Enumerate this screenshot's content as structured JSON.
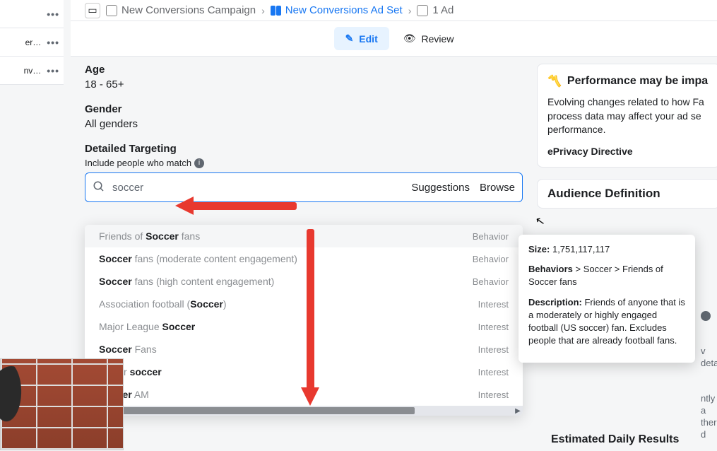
{
  "sidebar_items": [
    "",
    "er…",
    "nv…"
  ],
  "breadcrumb": {
    "campaign": "New Conversions Campaign",
    "adset": "New Conversions Ad Set",
    "ad": "1 Ad"
  },
  "actions": {
    "edit": "Edit",
    "review": "Review"
  },
  "form": {
    "age_label": "Age",
    "age_value": "18 - 65+",
    "gender_label": "Gender",
    "gender_value": "All genders",
    "targeting_label": "Detailed Targeting",
    "include_label": "Include people who match",
    "search_value": "soccer",
    "suggestions": "Suggestions",
    "browse": "Browse"
  },
  "dropdown": [
    {
      "pre": "Friends of ",
      "bold": "Soccer",
      "post": " fans",
      "cat": "Behavior"
    },
    {
      "pre": "",
      "bold": "Soccer",
      "post": " fans (moderate content engagement)",
      "cat": "Behavior"
    },
    {
      "pre": "",
      "bold": "Soccer",
      "post": " fans (high content engagement)",
      "cat": "Behavior"
    },
    {
      "pre": "Association football (",
      "bold": "Soccer",
      "post": ")",
      "cat": "Interest"
    },
    {
      "pre": "Major League ",
      "bold": "Soccer",
      "post": "",
      "cat": "Interest"
    },
    {
      "pre": "",
      "bold": "Soccer",
      "post": " Fans",
      "cat": "Interest"
    },
    {
      "pre": "Indoor ",
      "bold": "soccer",
      "post": "",
      "cat": "Interest"
    },
    {
      "pre": "",
      "bold": "Soccer",
      "post": " AM",
      "cat": "Interest"
    }
  ],
  "right": {
    "perf_title": "Performance may be impa",
    "perf_body": "Evolving changes related to how Fa process data may affect your ad se performance.",
    "perf_link": "ePrivacy Directive",
    "aud_title": "Audience Definition",
    "est_title": "Estimated Daily Results",
    "frag1": "v deta",
    "frag2": "ntly a",
    "frag3": "ther d"
  },
  "tooltip": {
    "size_label": "Size:",
    "size_value": "1,751,117,117",
    "beh_label": "Behaviors",
    "beh_path": " > Soccer > Friends of Soccer fans",
    "desc_label": "Description:",
    "desc_value": " Friends of anyone that is a moderately or highly engaged football (US soccer) fan. Excludes people that are already football fans."
  }
}
